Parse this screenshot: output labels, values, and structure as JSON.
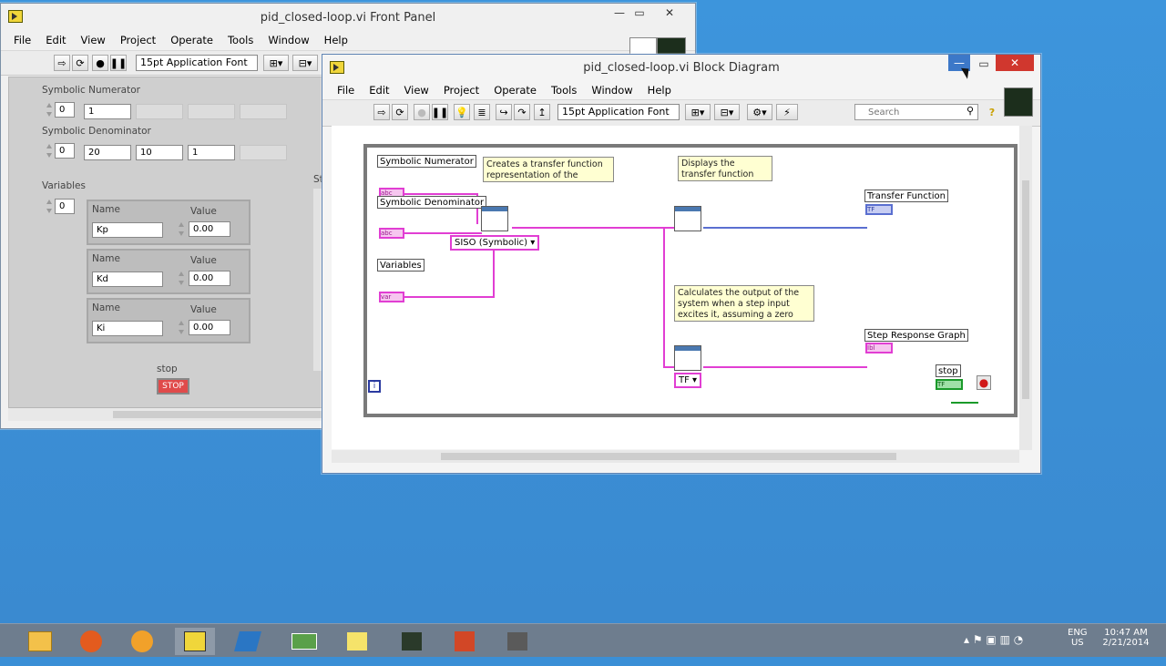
{
  "front_panel": {
    "title": "pid_closed-loop.vi Front Panel",
    "menu": [
      "File",
      "Edit",
      "View",
      "Project",
      "Operate",
      "Tools",
      "Window",
      "Help"
    ],
    "font": "15pt Application Font",
    "symbolic_numerator": {
      "label": "Symbolic Numerator",
      "index": "0",
      "values": [
        "1",
        "",
        "",
        ""
      ]
    },
    "symbolic_denominator": {
      "label": "Symbolic Denominator",
      "index": "0",
      "values": [
        "20",
        "10",
        "1",
        ""
      ]
    },
    "variables": {
      "label": "Variables",
      "index": "0",
      "items": [
        {
          "name_label": "Name",
          "name": "Kp",
          "value_label": "Value",
          "value": "0.00"
        },
        {
          "name_label": "Name",
          "name": "Kd",
          "value_label": "Value",
          "value": "0.00"
        },
        {
          "name_label": "Name",
          "name": "Ki",
          "value_label": "Value",
          "value": "0.00"
        }
      ]
    },
    "stop": {
      "label": "stop",
      "button": "STOP"
    },
    "partial_label": "St"
  },
  "block_diagram": {
    "title": "pid_closed-loop.vi Block Diagram",
    "menu": [
      "File",
      "Edit",
      "View",
      "Project",
      "Operate",
      "Tools",
      "Window",
      "Help"
    ],
    "font": "15pt Application Font",
    "search_placeholder": "Search",
    "help_glyph": "?",
    "labels": {
      "sym_num": "Symbolic Numerator",
      "sym_den": "Symbolic Denominator",
      "variables": "Variables",
      "tf": "Transfer Function",
      "step": "Step Response Graph",
      "stop": "stop",
      "siso": "SISO (Symbolic)",
      "tf_ring": "TF",
      "iteration": "i"
    },
    "comments": {
      "c1": "Creates a transfer function representation of the",
      "c2": "Displays the transfer function",
      "c3": "Calculates the output of the system when a step input excites it, assuming a zero"
    },
    "terminals": {
      "abc": "abc",
      "var": "var",
      "tf_t": "TF",
      "step_t": "Ibl",
      "bool": "TF"
    }
  },
  "taskbar": {
    "lang": "ENG",
    "region": "US",
    "time": "10:47 AM",
    "date": "2/21/2014"
  },
  "colors": {
    "wire_tf": "#e13ed3",
    "wire_display": "#5a6fd0",
    "loop": "#7a7a7a",
    "stop_green": "#1a9a2a"
  }
}
